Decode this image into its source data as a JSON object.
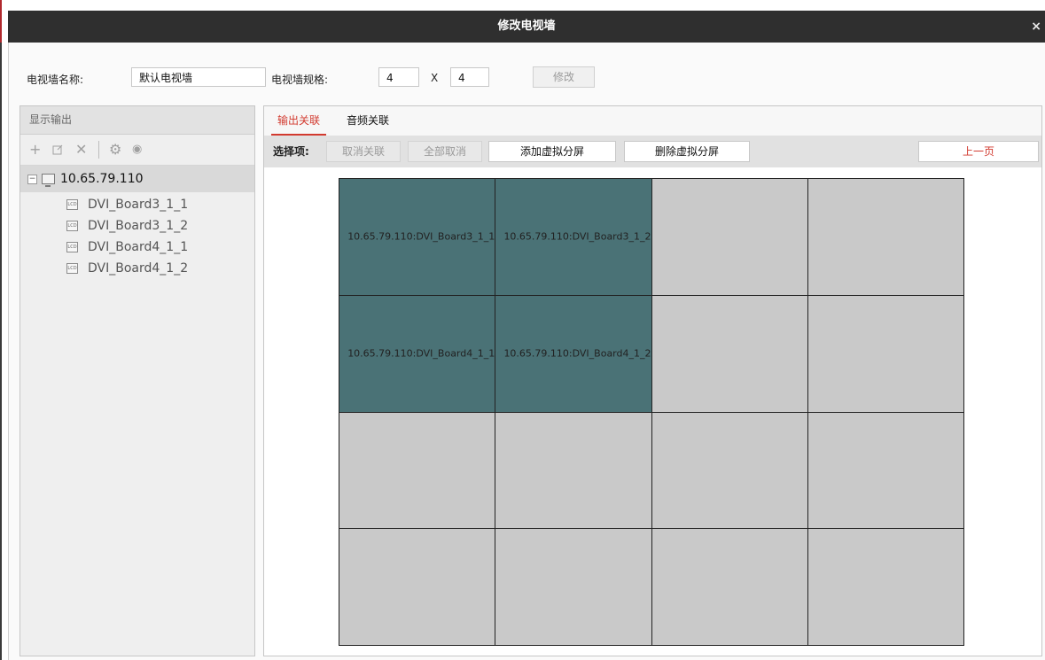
{
  "window": {
    "title": "修改电视墙",
    "close_glyph": "×"
  },
  "form": {
    "name_label": "电视墙名称:",
    "name_value": "默认电视墙",
    "spec_label": "电视墙规格:",
    "rows": "4",
    "x_sep": "X",
    "cols": "4",
    "modify_label": "修改"
  },
  "left_panel": {
    "header": "显示输出",
    "tool_icons": [
      "plus-icon",
      "edit-icon",
      "delete-icon",
      "gear-icon",
      "eye-icon"
    ],
    "tree": {
      "root_toggle": "−",
      "root": "10.65.79.110",
      "children": [
        "DVI_Board3_1_1",
        "DVI_Board3_1_2",
        "DVI_Board4_1_1",
        "DVI_Board4_1_2"
      ],
      "child_icon_text": "LCD"
    }
  },
  "right_panel": {
    "tabs": [
      {
        "label": "输出关联",
        "active": true
      },
      {
        "label": "音频关联",
        "active": false
      }
    ],
    "toolbar": {
      "select_label": "选择项:",
      "unbind": "取消关联",
      "cancel_all": "全部取消",
      "add_virtual": "添加虚拟分屏",
      "del_virtual": "删除虚拟分屏",
      "prev_page": "上一页"
    },
    "grid": {
      "rows": 4,
      "cols": 4,
      "cells": [
        {
          "text": "10.65.79.110:DVI_Board3_1_1",
          "bound": true
        },
        {
          "text": "10.65.79.110:DVI_Board3_1_2",
          "bound": true
        },
        {
          "text": "",
          "bound": false
        },
        {
          "text": "",
          "bound": false
        },
        {
          "text": "10.65.79.110:DVI_Board4_1_1",
          "bound": true
        },
        {
          "text": "10.65.79.110:DVI_Board4_1_2",
          "bound": true
        },
        {
          "text": "",
          "bound": false
        },
        {
          "text": "",
          "bound": false
        },
        {
          "text": "",
          "bound": false
        },
        {
          "text": "",
          "bound": false
        },
        {
          "text": "",
          "bound": false
        },
        {
          "text": "",
          "bound": false
        },
        {
          "text": "",
          "bound": false
        },
        {
          "text": "",
          "bound": false
        },
        {
          "text": "",
          "bound": false
        },
        {
          "text": "",
          "bound": false
        }
      ]
    }
  },
  "colors": {
    "titlebar": "#2f2f2f",
    "accent_red": "#d23a2f",
    "bound_cell": "#4a7276",
    "empty_cell": "#c9c9c9"
  }
}
